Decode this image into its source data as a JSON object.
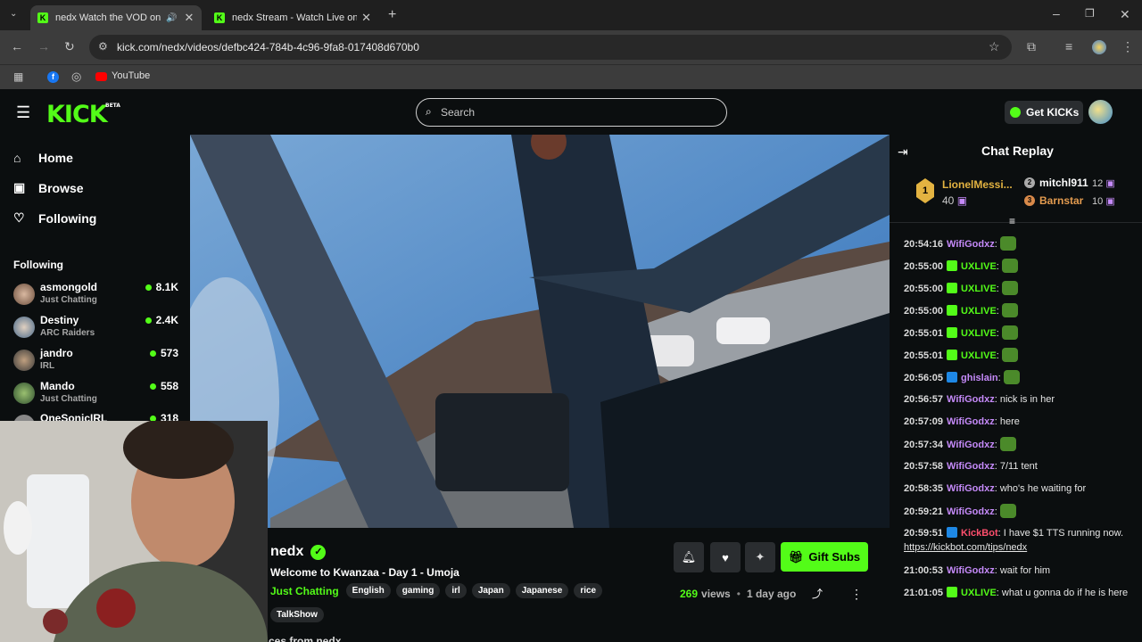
{
  "browser": {
    "tabs": [
      {
        "title": "nedx Watch the VOD on Ki"
      },
      {
        "title": "nedx Stream - Watch Live on Ki"
      }
    ],
    "url": "kick.com/nedx/videos/defbc424-784b-4c96-9fa8-017408d670b0",
    "bookmarks": [
      {
        "label": "YouTube"
      }
    ]
  },
  "header": {
    "logo": "KICK",
    "logo_badge": "BETA",
    "search_placeholder": "Search",
    "get_kicks": "Get KICKs"
  },
  "sidebar": {
    "nav": [
      {
        "label": "Home",
        "icon": "home-icon"
      },
      {
        "label": "Browse",
        "icon": "browse-icon"
      },
      {
        "label": "Following",
        "icon": "heart-icon"
      }
    ],
    "following_title": "Following",
    "following": [
      {
        "name": "asmongold",
        "category": "Just Chatting",
        "viewers": "8.1K"
      },
      {
        "name": "Destiny",
        "category": "ARC Raiders",
        "viewers": "2.4K"
      },
      {
        "name": "jandro",
        "category": "IRL",
        "viewers": "573"
      },
      {
        "name": "Mando",
        "category": "Just Chatting",
        "viewers": "558"
      },
      {
        "name": "OneSonicIRL",
        "category": "",
        "viewers": "318"
      }
    ]
  },
  "stream": {
    "channel": "nedx",
    "title": "Welcome to Kwanzaa - Day 1 - Umoja",
    "category": "Just Chatting",
    "tags": [
      "English",
      "gaming",
      "irl",
      "Japan",
      "Japanese",
      "rice",
      "TalkShow"
    ],
    "views_count": "269",
    "views_label": "views",
    "age": "1 day ago",
    "gift_label": "Gift Subs",
    "below_text": "ces from nedx"
  },
  "chat": {
    "title": "Chat Replay",
    "leaderboard": {
      "first": {
        "rank": "1",
        "name": "LionelMessi...",
        "count": "40"
      },
      "second": {
        "rank": "2",
        "name": "mitchl911",
        "count": "12"
      },
      "third": {
        "rank": "3",
        "name": "Barnstar",
        "count": "10"
      }
    },
    "messages": [
      {
        "time": "20:54:16",
        "user": "WifiGodxz",
        "color": "#c58af9",
        "text": "",
        "emote": true
      },
      {
        "time": "20:55:00",
        "user": "UXLIVE",
        "color": "#53fc18",
        "text": "",
        "emote": true
      },
      {
        "time": "20:55:00",
        "user": "UXLIVE",
        "color": "#53fc18",
        "text": "",
        "emote": true
      },
      {
        "time": "20:55:00",
        "user": "UXLIVE",
        "color": "#53fc18",
        "text": "",
        "emote": true
      },
      {
        "time": "20:55:01",
        "user": "UXLIVE",
        "color": "#53fc18",
        "text": "",
        "emote": true
      },
      {
        "time": "20:55:01",
        "user": "UXLIVE",
        "color": "#53fc18",
        "text": "",
        "emote": true
      },
      {
        "time": "20:56:05",
        "user": "ghislain",
        "color": "#c58af9",
        "text": "",
        "emote": true
      },
      {
        "time": "20:56:57",
        "user": "WifiGodxz",
        "color": "#c58af9",
        "text": "nick is in her"
      },
      {
        "time": "20:57:09",
        "user": "WifiGodxz",
        "color": "#c58af9",
        "text": "here"
      },
      {
        "time": "20:57:34",
        "user": "WifiGodxz",
        "color": "#c58af9",
        "text": "",
        "emote": true
      },
      {
        "time": "20:57:58",
        "user": "WifiGodxz",
        "color": "#c58af9",
        "text": "7/11 tent"
      },
      {
        "time": "20:58:35",
        "user": "WifiGodxz",
        "color": "#c58af9",
        "text": "who's he waiting for"
      },
      {
        "time": "20:59:21",
        "user": "WifiGodxz",
        "color": "#c58af9",
        "text": "",
        "emote": true
      },
      {
        "time": "20:59:51",
        "user": "KickBot",
        "color": "#ff4f6d",
        "text": "I have $1 TTS running now.",
        "link": "https://kickbot.com/tips/nedx"
      },
      {
        "time": "21:00:53",
        "user": "WifiGodxz",
        "color": "#c58af9",
        "text": "wait for him"
      },
      {
        "time": "21:01:05",
        "user": "UXLIVE",
        "color": "#53fc18",
        "text": "what u gonna do if he is here"
      }
    ]
  }
}
